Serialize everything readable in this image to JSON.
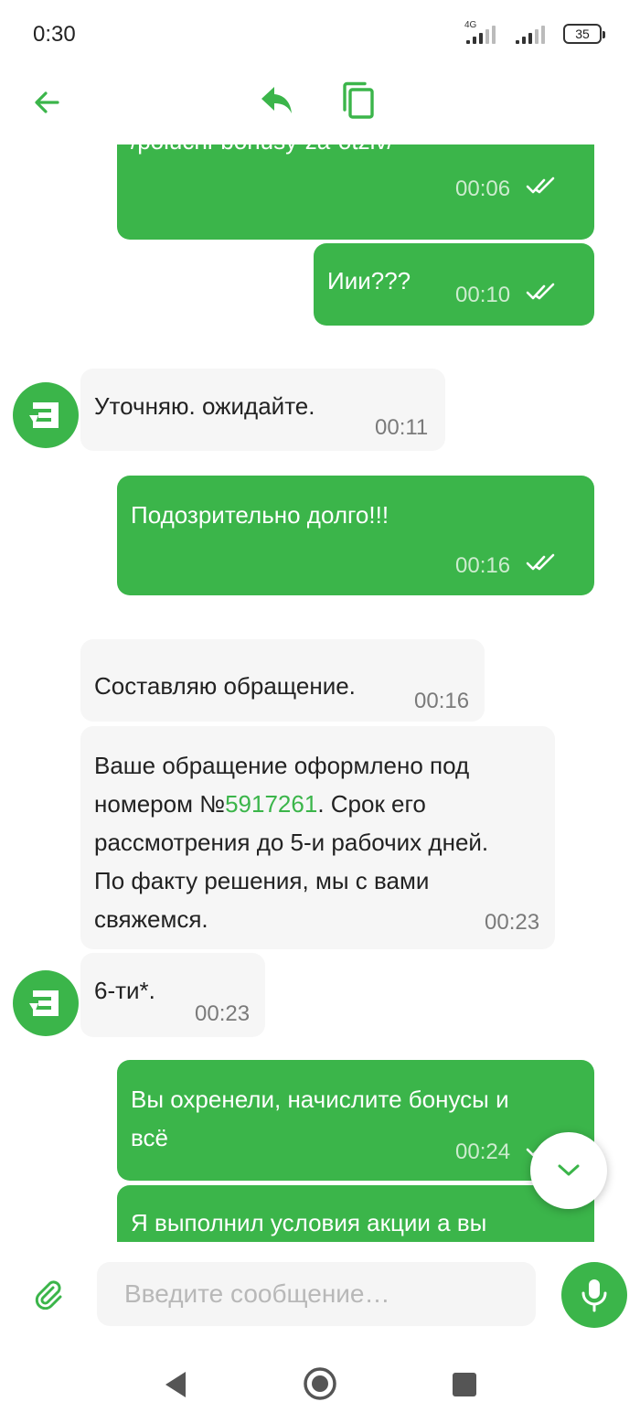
{
  "status_bar": {
    "time": "0:30",
    "network": "4G",
    "battery": "35"
  },
  "toolbar": {
    "back_icon": "arrow-left-icon",
    "reply_icon": "reply-icon",
    "copy_icon": "copy-icon"
  },
  "messages": [
    {
      "direction": "out",
      "text": "/poluchi-bonusy-za-otziv/",
      "time": "00:06",
      "status": "read"
    },
    {
      "direction": "out",
      "text": "Иии???",
      "time": "00:10",
      "status": "read"
    },
    {
      "direction": "in",
      "text": "Уточняю. ожидайте.",
      "time": "00:11"
    },
    {
      "direction": "out",
      "text": "Подозрительно долго!!!",
      "time": "00:16",
      "status": "read"
    },
    {
      "direction": "in",
      "text": "Составляю обращение.",
      "time": "00:16"
    },
    {
      "direction": "in",
      "lines": [
        {
          "before": "Ваше обращение оформлено под",
          "link": "",
          "after": ""
        },
        {
          "before": "номером №",
          "link": "5917261",
          "after": ". Срок его"
        },
        {
          "before": "рассмотрения до 5-и рабочих дней.",
          "link": "",
          "after": ""
        },
        {
          "before": "По факту решения, мы с вами",
          "link": "",
          "after": ""
        },
        {
          "before": "свяжемся.",
          "link": "",
          "after": ""
        }
      ],
      "time": "00:23"
    },
    {
      "direction": "in",
      "text": "6-ти*.",
      "time": "00:23"
    },
    {
      "direction": "out",
      "lines": [
        "Вы охренели, начислите бонусы и",
        "всё"
      ],
      "time": "00:24",
      "status": "read"
    },
    {
      "direction": "out",
      "text": "Я выполнил условия акции а вы"
    }
  ],
  "composer": {
    "placeholder": "Введите сообщение…",
    "attach_icon": "paperclip-icon",
    "mic_icon": "microphone-icon"
  },
  "colors": {
    "accent": "#3bb54a",
    "incoming_bubble": "#f6f6f6",
    "outgoing_bubble": "#3bb54a"
  }
}
